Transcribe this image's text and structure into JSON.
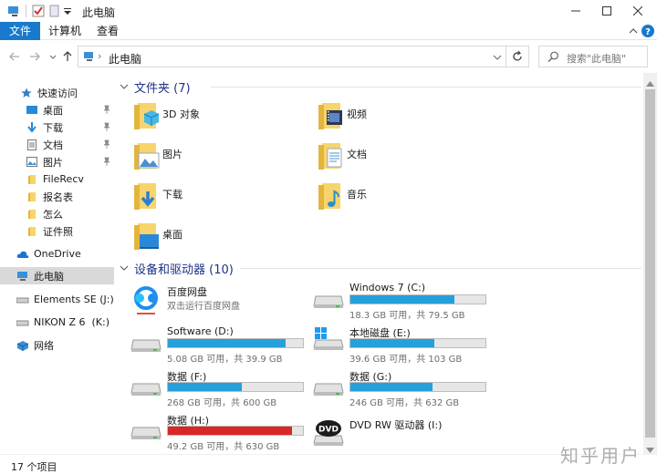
{
  "window": {
    "title": "此电脑"
  },
  "ribbon": {
    "tabs": [
      "文件",
      "计算机",
      "查看"
    ]
  },
  "address": {
    "path": "此电脑",
    "search_placeholder": "搜索\"此电脑\""
  },
  "sidebar": {
    "quick_access": "快速访问",
    "items": [
      {
        "label": "桌面",
        "icon": "desktop-icon",
        "pinned": true
      },
      {
        "label": "下载",
        "icon": "download-icon",
        "pinned": true
      },
      {
        "label": "文档",
        "icon": "document-icon",
        "pinned": true
      },
      {
        "label": "图片",
        "icon": "picture-icon",
        "pinned": true
      },
      {
        "label": "FileRecv",
        "icon": "folder-icon",
        "pinned": false
      },
      {
        "label": "报名表",
        "icon": "folder-icon",
        "pinned": false
      },
      {
        "label": "怎么",
        "icon": "folder-icon",
        "pinned": false
      },
      {
        "label": "证件照",
        "icon": "folder-icon",
        "pinned": false
      }
    ],
    "onedrive": "OneDrive",
    "this_pc": "此电脑",
    "elements": "Elements SE (J:)",
    "nikon": "NIKON Z 6  (K:)",
    "network": "网络"
  },
  "folders": {
    "header": "文件夹 (7)",
    "items": [
      {
        "name": "3D 对象"
      },
      {
        "name": "视频"
      },
      {
        "name": "图片"
      },
      {
        "name": "文档"
      },
      {
        "name": "下载"
      },
      {
        "name": "音乐"
      },
      {
        "name": "桌面"
      }
    ]
  },
  "drives": {
    "header": "设备和驱动器 (10)",
    "baidu": {
      "name": "百度网盘",
      "sub": "双击运行百度网盘"
    },
    "items": [
      {
        "name": "Windows 7 (C:)",
        "used": 0.77,
        "free_text": "18.3 GB 可用，共 79.5 GB"
      },
      {
        "name": "Software (D:)",
        "used": 0.87,
        "free_text": "5.08 GB 可用，共 39.9 GB"
      },
      {
        "name": "本地磁盘 (E:)",
        "used": 0.62,
        "free_text": "39.6 GB 可用，共 103 GB"
      },
      {
        "name": "数据 (F:)",
        "used": 0.55,
        "free_text": "268 GB 可用，共 600 GB"
      },
      {
        "name": "数据 (G:)",
        "used": 0.61,
        "free_text": "246 GB 可用，共 632 GB"
      },
      {
        "name": "数据 (H:)",
        "used": 0.92,
        "free_text": "49.2 GB 可用，共 630 GB"
      }
    ],
    "dvd": {
      "name": "DVD RW 驱动器 (I:)",
      "label": "DVD"
    }
  },
  "status": {
    "count": "17 个项目"
  },
  "watermark": "知乎用户"
}
